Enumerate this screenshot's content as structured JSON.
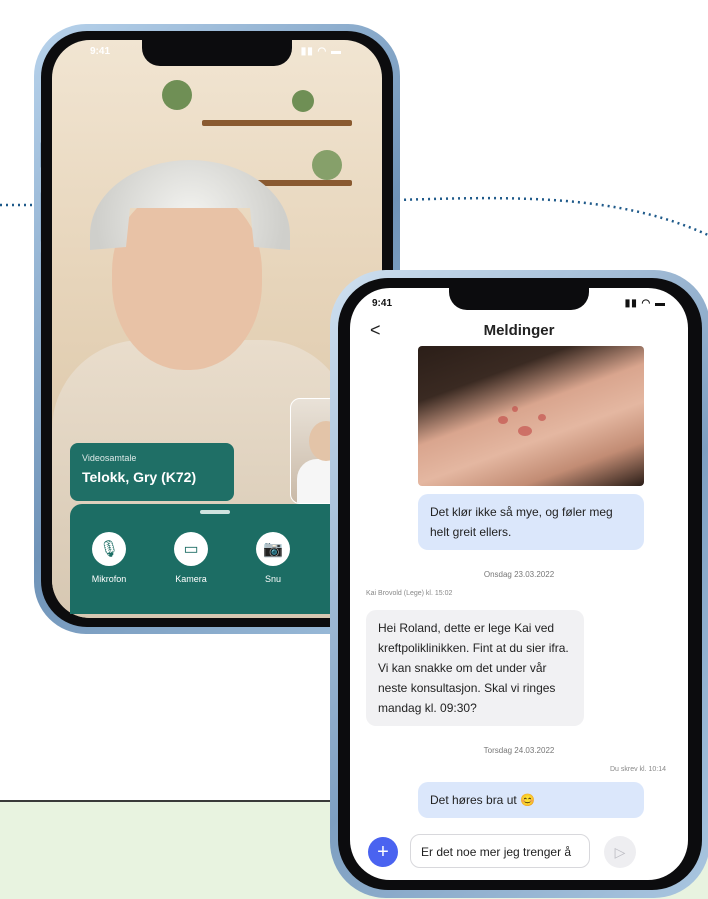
{
  "video_call": {
    "status_time": "9:41",
    "status_icons": "▮▮ ◠ ▬",
    "label": "Videosamtale",
    "name": "Telokk, Gry (K72)",
    "controls": [
      {
        "icon": "microphone-icon",
        "glyph": "🎙",
        "label": "Mikrofon"
      },
      {
        "icon": "camera-icon",
        "glyph": "▭",
        "label": "Kamera"
      },
      {
        "icon": "flip-camera-icon",
        "glyph": "📷",
        "label": "Snu"
      }
    ]
  },
  "messages_screen": {
    "status_time": "9:41",
    "status_icons": "▮▮ ◠ ▬",
    "back_glyph": "<",
    "title": "Meldinger",
    "msg1": "Det klør ikke så mye, og føler meg helt greit ellers.",
    "date1": "Onsdag 23.03.2022",
    "sender_meta": "Kai Brovold (Lege) kl. 15:02",
    "msg2": "Hei Roland, dette er lege Kai ved kreftpoliklinikken. Fint at du sier ifra. Vi kan snakke om det under vår neste konsultasjon. Skal vi ringes mandag kl. 09:30?",
    "date2": "Torsdag 24.03.2022",
    "you_meta": "Du skrev kl. 10:14",
    "msg3": "Det høres bra ut 😊",
    "input_value": "Er det noe mer jeg trenger å",
    "plus_glyph": "+",
    "send_glyph": "▷"
  },
  "colors": {
    "teal": "#1c6d64",
    "bubble_blue": "#dbe7fb",
    "accent_blue": "#4a63f0",
    "band_green": "#e8f3e0",
    "dots": "#1f5a8a"
  }
}
